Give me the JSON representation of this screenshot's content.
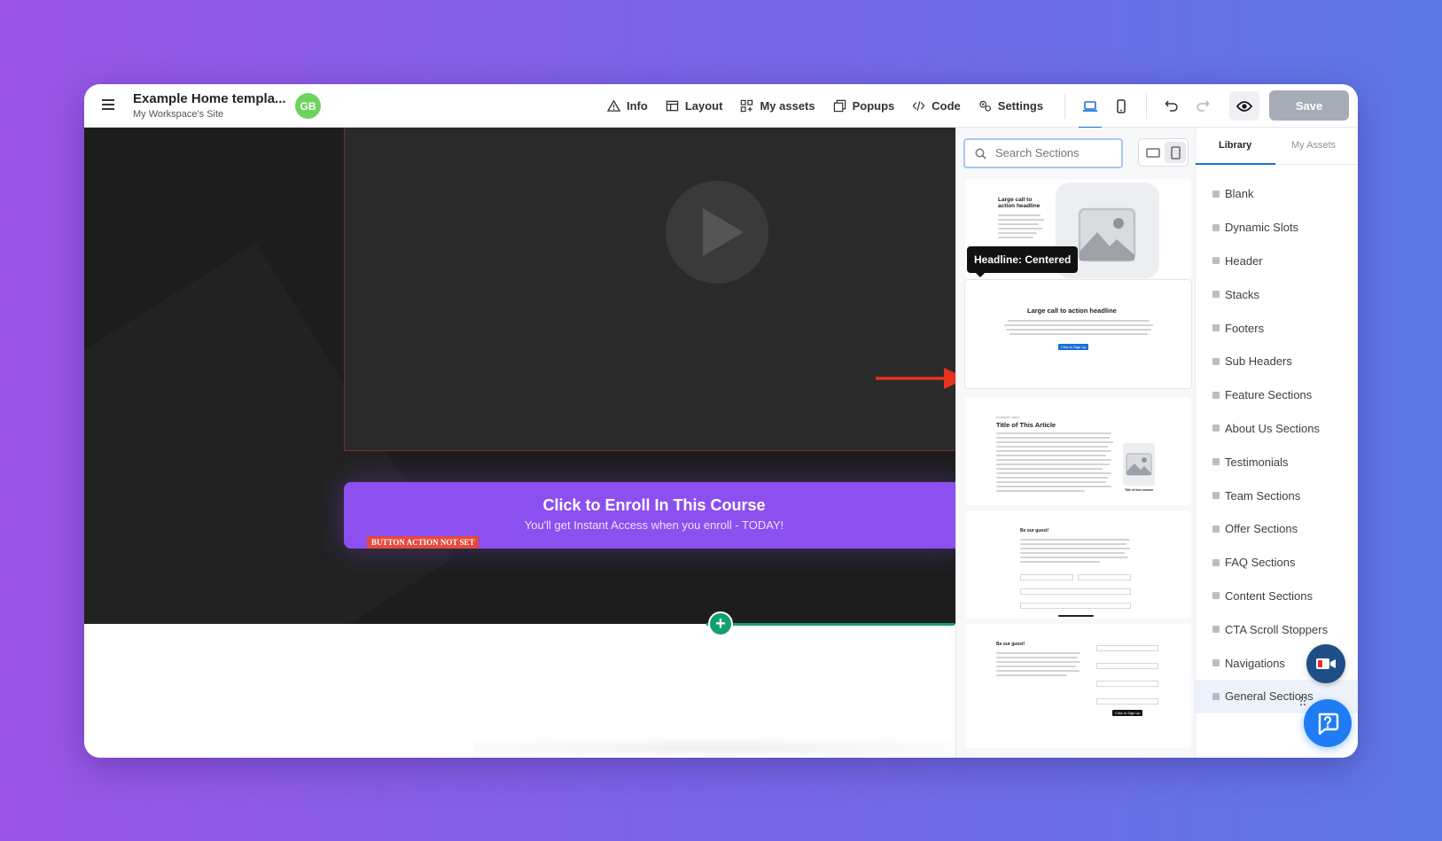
{
  "header": {
    "title": "Example Home templa...",
    "subtitle": "My Workspace's Site",
    "avatar_initials": "GB",
    "menu": [
      {
        "label": "Info",
        "icon": "warning-triangle-icon"
      },
      {
        "label": "Layout",
        "icon": "layout-icon"
      },
      {
        "label": "My assets",
        "icon": "assets-icon"
      },
      {
        "label": "Popups",
        "icon": "popups-icon"
      },
      {
        "label": "Code",
        "icon": "code-icon"
      },
      {
        "label": "Settings",
        "icon": "settings-icon"
      }
    ],
    "save_label": "Save",
    "accent_color": "#1a6fd8"
  },
  "canvas": {
    "cta_title": "Click to Enroll In This Course",
    "cta_subtitle": "You'll get Instant Access when you enroll - TODAY!",
    "cta_badge": "BUTTON ACTION NOT SET",
    "cta_color": "#8c4ff0",
    "add_label": "+"
  },
  "sections": {
    "search_placeholder": "Search Sections",
    "tooltip": "Headline: Centered",
    "thumb1_title_line1": "Large call to",
    "thumb1_title_line2": "action headline",
    "thumb2_title": "Large call to action headline",
    "thumb2_button": "Click to Sign Up",
    "thumb3_eyebrow": "Example Label",
    "thumb3_title": "Title of This Article",
    "thumb3_caption": "Title of this column",
    "thumb4_title": "Be our guest!",
    "thumb5_title": "Be our guest!",
    "thumb5_button": "Click to Sign Up"
  },
  "library": {
    "tabs": [
      "Library",
      "My Assets"
    ],
    "categories": [
      "Blank",
      "Dynamic Slots",
      "Header",
      "Stacks",
      "Footers",
      "Sub Headers",
      "Feature Sections",
      "About Us Sections",
      "Testimonials",
      "Team Sections",
      "Offer Sections",
      "FAQ Sections",
      "Content Sections",
      "CTA Scroll Stoppers",
      "Navigations",
      "General Sections"
    ]
  }
}
